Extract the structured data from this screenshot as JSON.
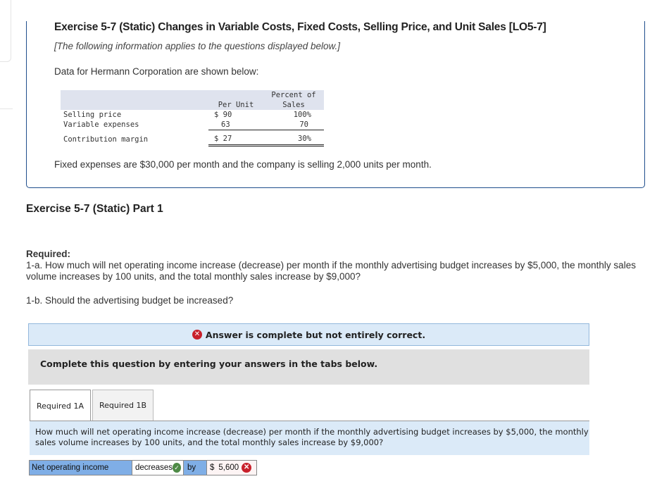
{
  "exercise": {
    "title": "Exercise 5-7 (Static) Changes in Variable Costs, Fixed Costs, Selling Price, and Unit Sales [LO5-7]",
    "note": "[The following information applies to the questions displayed below.]",
    "data_intro": "Data for Hermann Corporation are shown below:",
    "table": {
      "headers": {
        "per_unit": "Per Unit",
        "percent_line1": "Percent of",
        "percent_line2": "Sales"
      },
      "rows": [
        {
          "label": "Selling price",
          "per_unit": "$ 90",
          "percent": "100%"
        },
        {
          "label": "Variable expenses",
          "per_unit": "63",
          "percent": "70"
        },
        {
          "label": "Contribution margin",
          "per_unit": "$ 27",
          "percent": "30%"
        }
      ]
    },
    "fixed_note": "Fixed expenses are $30,000 per month and the company is selling 2,000 units per month."
  },
  "part": {
    "title": "Exercise 5-7 (Static) Part 1",
    "required_heading": "Required:",
    "q1a": "1-a. How much will net operating income increase (decrease) per month if the monthly advertising budget increases by $5,000, the monthly sales volume increases by 100 units, and the total monthly sales increase by $9,000?",
    "q1b": "1-b. Should the advertising budget be increased?"
  },
  "status": {
    "icon": "x-circle-icon",
    "text": "Answer is complete but not entirely correct.",
    "color": "#c8202b"
  },
  "instructions": "Complete this question by entering your answers in the tabs below.",
  "tabs": [
    {
      "label": "Required 1A",
      "active": true
    },
    {
      "label": "Required 1B",
      "active": false
    }
  ],
  "question_panel": {
    "text": "How much will net operating income increase (decrease) per month if the monthly advertising budget increases by $5,000, the monthly sales volume increases by 100 units, and the total monthly sales increase by $9,000?"
  },
  "answer": {
    "label": "Net operating income",
    "direction": "decreases",
    "direction_status": "correct",
    "by_label": "by",
    "currency": "$",
    "amount": "5,600",
    "amount_status": "incorrect"
  },
  "colors": {
    "frame_border": "#1f4e8c",
    "status_bg": "#dbeaf8",
    "label_cell_bg": "#7faee6",
    "correct_green": "#4e8a46",
    "incorrect_red": "#c8202b"
  }
}
